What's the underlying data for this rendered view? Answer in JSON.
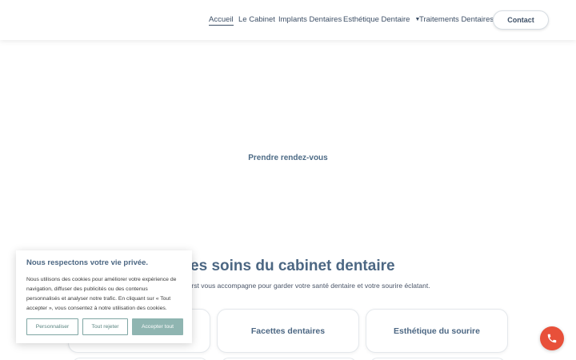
{
  "nav": {
    "items": [
      {
        "label": "Accueil",
        "active": true
      },
      {
        "label": "Le Cabinet"
      },
      {
        "label": "Implants Dentaires"
      },
      {
        "label": "Esthétique Dentaire",
        "has_dropdown": true
      },
      {
        "label": "Traitements Dentaires"
      }
    ],
    "contact_label": "Contact"
  },
  "hero": {
    "cta_label": "Prendre rendez-vous"
  },
  "services": {
    "title": "Les soins du cabinet dentaire",
    "subtitle": "cteur Vandervorst vous accompagne pour garder votre santé dentaire et votre sourire éclatant.",
    "cards": [
      {
        "label": ""
      },
      {
        "label": "Facettes dentaires"
      },
      {
        "label": "Esthétique du sourire"
      }
    ]
  },
  "cookie_banner": {
    "title": "Nous respectons votre vie privée.",
    "text": "Nous utilisons des cookies pour améliorer votre expérience de navigation, diffuser des publicités ou des contenus personnalisés et analyser notre trafic. En cliquant sur « Tout accepter », vous consentez à notre utilisation des cookies.",
    "customize_label": "Personnaliser",
    "reject_label": "Tout rejeter",
    "accept_label": "Accepter tout"
  },
  "floating": {
    "phone_icon": "phone-icon"
  },
  "colors": {
    "accent": "#4c6783",
    "cookie_button": "#8fb5b1",
    "phone_button": "#e8503a"
  }
}
